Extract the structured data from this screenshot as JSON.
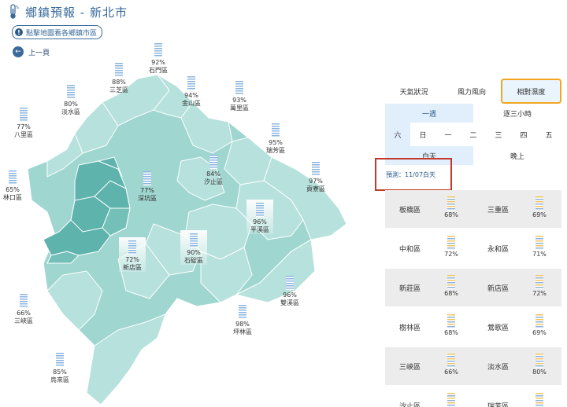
{
  "header": {
    "title": "鄉鎮預報 - 新北市"
  },
  "hint": {
    "text": "點擊地圖看各鄉鎮市區"
  },
  "back": {
    "label": "上一頁"
  },
  "colors": {
    "accent": "#3a6a9a",
    "map_fill": "#9fd6d0",
    "map_selected": "#5fb3ad",
    "active_tab_border": "#f2a623",
    "highlight_box": "#c0392b"
  },
  "map_markers": [
    {
      "name": "石門區",
      "value": "92%"
    },
    {
      "name": "三芝區",
      "value": "88%"
    },
    {
      "name": "金山區",
      "value": "94%"
    },
    {
      "name": "萬里區",
      "value": "93%"
    },
    {
      "name": "淡水區",
      "value": "80%"
    },
    {
      "name": "八里區",
      "value": "77%"
    },
    {
      "name": "瑞芳區",
      "value": "95%"
    },
    {
      "name": "汐止區",
      "value": "84%"
    },
    {
      "name": "林口區",
      "value": "65%"
    },
    {
      "name": "深坑區",
      "value": "77%"
    },
    {
      "name": "貢寮區",
      "value": "97%"
    },
    {
      "name": "平溪區",
      "value": "96%"
    },
    {
      "name": "新店區",
      "value": "72%"
    },
    {
      "name": "石碇區",
      "value": "90%"
    },
    {
      "name": "三峽區",
      "value": "66%"
    },
    {
      "name": "雙溪區",
      "value": "96%"
    },
    {
      "name": "坪林區",
      "value": "98%"
    },
    {
      "name": "烏來區",
      "value": "85%"
    }
  ],
  "tabs": [
    {
      "label": "天氣狀況"
    },
    {
      "label": "風力風向"
    },
    {
      "label": "相對濕度"
    }
  ],
  "periods": [
    {
      "label": "一週"
    },
    {
      "label": "逐三小時"
    }
  ],
  "days": [
    "六",
    "日",
    "一",
    "二",
    "三",
    "四",
    "五"
  ],
  "daynight": [
    {
      "label": "白天"
    },
    {
      "label": "晚上"
    }
  ],
  "forecast_label": "預測：11/07白天",
  "list": [
    [
      {
        "name": "板橋區",
        "value": "68%"
      },
      {
        "name": "三重區",
        "value": "69%"
      }
    ],
    [
      {
        "name": "中和區",
        "value": "72%"
      },
      {
        "name": "永和區",
        "value": "71%"
      }
    ],
    [
      {
        "name": "新莊區",
        "value": "68%"
      },
      {
        "name": "新店區",
        "value": "72%"
      }
    ],
    [
      {
        "name": "樹林區",
        "value": "68%"
      },
      {
        "name": "鶯歌區",
        "value": "69%"
      }
    ],
    [
      {
        "name": "三峽區",
        "value": "66%"
      },
      {
        "name": "淡水區",
        "value": "80%"
      }
    ],
    [
      {
        "name": "汐止區",
        "value": ""
      },
      {
        "name": "瑞芳區",
        "value": ""
      }
    ]
  ]
}
